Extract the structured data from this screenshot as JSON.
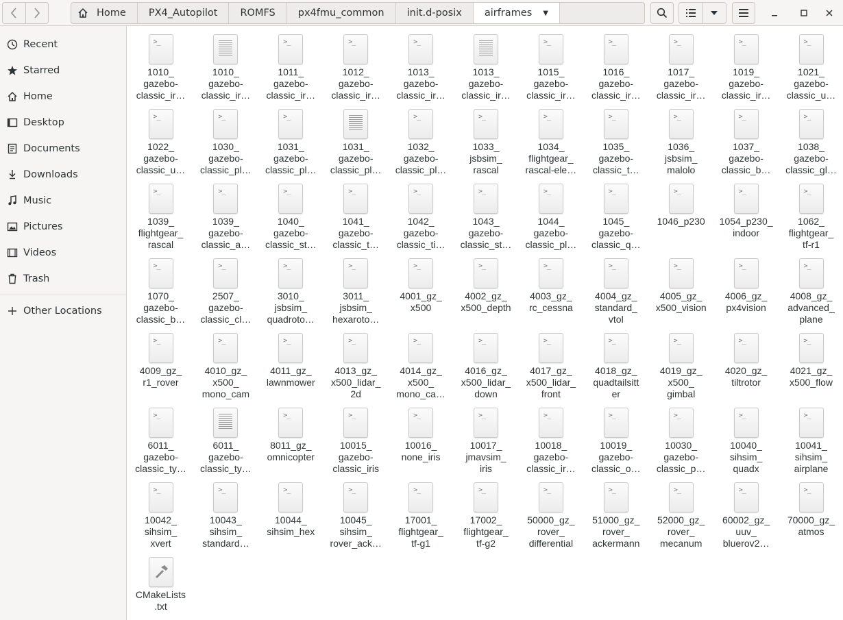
{
  "nav": {
    "back_label": "‹",
    "forward_label": "›"
  },
  "pathbar": {
    "crumbs": [
      "Home",
      "PX4_Autopilot",
      "ROMFS",
      "px4fmu_common",
      "init.d-posix",
      "airframes"
    ]
  },
  "sidebar": {
    "items": [
      {
        "label": "Recent",
        "icon": "clock-icon"
      },
      {
        "label": "Starred",
        "icon": "star-icon"
      },
      {
        "label": "Home",
        "icon": "home-icon"
      },
      {
        "label": "Desktop",
        "icon": "desktop-icon"
      },
      {
        "label": "Documents",
        "icon": "documents-icon"
      },
      {
        "label": "Downloads",
        "icon": "download-icon"
      },
      {
        "label": "Music",
        "icon": "music-icon"
      },
      {
        "label": "Pictures",
        "icon": "pictures-icon"
      },
      {
        "label": "Videos",
        "icon": "videos-icon"
      },
      {
        "label": "Trash",
        "icon": "trash-icon"
      }
    ],
    "other_locations": "Other Locations"
  },
  "files": [
    {
      "name": [
        "1010_",
        "gazebo-",
        "classic_ir…"
      ],
      "type": "script"
    },
    {
      "name": [
        "1010_",
        "gazebo-",
        "classic_ir…"
      ],
      "type": "text"
    },
    {
      "name": [
        "1011_",
        "gazebo-",
        "classic_ir…"
      ],
      "type": "script"
    },
    {
      "name": [
        "1012_",
        "gazebo-",
        "classic_ir…"
      ],
      "type": "script"
    },
    {
      "name": [
        "1013_",
        "gazebo-",
        "classic_ir…"
      ],
      "type": "script"
    },
    {
      "name": [
        "1013_",
        "gazebo-",
        "classic_ir…"
      ],
      "type": "text"
    },
    {
      "name": [
        "1015_",
        "gazebo-",
        "classic_ir…"
      ],
      "type": "script"
    },
    {
      "name": [
        "1016_",
        "gazebo-",
        "classic_ir…"
      ],
      "type": "script"
    },
    {
      "name": [
        "1017_",
        "gazebo-",
        "classic_ir…"
      ],
      "type": "script"
    },
    {
      "name": [
        "1019_",
        "gazebo-",
        "classic_ir…"
      ],
      "type": "script"
    },
    {
      "name": [
        "1021_",
        "gazebo-",
        "classic_u…"
      ],
      "type": "script"
    },
    {
      "name": [
        "1022_",
        "gazebo-",
        "classic_u…"
      ],
      "type": "script"
    },
    {
      "name": [
        "1030_",
        "gazebo-",
        "classic_pl…"
      ],
      "type": "script"
    },
    {
      "name": [
        "1031_",
        "gazebo-",
        "classic_pl…"
      ],
      "type": "script"
    },
    {
      "name": [
        "1031_",
        "gazebo-",
        "classic_pl…"
      ],
      "type": "text"
    },
    {
      "name": [
        "1032_",
        "gazebo-",
        "classic_pl…"
      ],
      "type": "script"
    },
    {
      "name": [
        "1033_",
        "jsbsim_",
        "rascal"
      ],
      "type": "script"
    },
    {
      "name": [
        "1034_",
        "flightgear_",
        "rascal-ele…"
      ],
      "type": "script"
    },
    {
      "name": [
        "1035_",
        "gazebo-",
        "classic_t…"
      ],
      "type": "script"
    },
    {
      "name": [
        "1036_",
        "jsbsim_",
        "malolo"
      ],
      "type": "script"
    },
    {
      "name": [
        "1037_",
        "gazebo-",
        "classic_b…"
      ],
      "type": "script"
    },
    {
      "name": [
        "1038_",
        "gazebo-",
        "classic_gl…"
      ],
      "type": "script"
    },
    {
      "name": [
        "1039_",
        "flightgear_",
        "rascal"
      ],
      "type": "script"
    },
    {
      "name": [
        "1039_",
        "gazebo-",
        "classic_a…"
      ],
      "type": "script"
    },
    {
      "name": [
        "1040_",
        "gazebo-",
        "classic_st…"
      ],
      "type": "script"
    },
    {
      "name": [
        "1041_",
        "gazebo-",
        "classic_t…"
      ],
      "type": "script"
    },
    {
      "name": [
        "1042_",
        "gazebo-",
        "classic_ti…"
      ],
      "type": "script"
    },
    {
      "name": [
        "1043_",
        "gazebo-",
        "classic_st…"
      ],
      "type": "script"
    },
    {
      "name": [
        "1044_",
        "gazebo-",
        "classic_pl…"
      ],
      "type": "script"
    },
    {
      "name": [
        "1045_",
        "gazebo-",
        "classic_q…"
      ],
      "type": "script"
    },
    {
      "name": [
        "1046_p230"
      ],
      "type": "script"
    },
    {
      "name": [
        "1054_p230_",
        "indoor"
      ],
      "type": "script"
    },
    {
      "name": [
        "1062_",
        "flightgear_",
        "tf-r1"
      ],
      "type": "script"
    },
    {
      "name": [
        "1070_",
        "gazebo-",
        "classic_b…"
      ],
      "type": "script"
    },
    {
      "name": [
        "2507_",
        "gazebo-",
        "classic_cl…"
      ],
      "type": "script"
    },
    {
      "name": [
        "3010_",
        "jsbsim_",
        "quadroto…"
      ],
      "type": "script"
    },
    {
      "name": [
        "3011_",
        "jsbsim_",
        "hexaroto…"
      ],
      "type": "script"
    },
    {
      "name": [
        "4001_gz_",
        "x500"
      ],
      "type": "script"
    },
    {
      "name": [
        "4002_gz_",
        "x500_depth"
      ],
      "type": "script"
    },
    {
      "name": [
        "4003_gz_",
        "rc_cessna"
      ],
      "type": "script"
    },
    {
      "name": [
        "4004_gz_",
        "standard_",
        "vtol"
      ],
      "type": "script"
    },
    {
      "name": [
        "4005_gz_",
        "x500_vision"
      ],
      "type": "script"
    },
    {
      "name": [
        "4006_gz_",
        "px4vision"
      ],
      "type": "script"
    },
    {
      "name": [
        "4008_gz_",
        "advanced_",
        "plane"
      ],
      "type": "script"
    },
    {
      "name": [
        "4009_gz_",
        "r1_rover"
      ],
      "type": "script"
    },
    {
      "name": [
        "4010_gz_",
        "x500_",
        "mono_cam"
      ],
      "type": "script"
    },
    {
      "name": [
        "4011_gz_",
        "lawnmower"
      ],
      "type": "script"
    },
    {
      "name": [
        "4013_gz_",
        "x500_lidar_",
        "2d"
      ],
      "type": "script"
    },
    {
      "name": [
        "4014_gz_",
        "x500_",
        "mono_ca…"
      ],
      "type": "script"
    },
    {
      "name": [
        "4016_gz_",
        "x500_lidar_",
        "down"
      ],
      "type": "script"
    },
    {
      "name": [
        "4017_gz_",
        "x500_lidar_",
        "front"
      ],
      "type": "script"
    },
    {
      "name": [
        "4018_gz_",
        "quadtailsitt",
        "er"
      ],
      "type": "script"
    },
    {
      "name": [
        "4019_gz_",
        "x500_",
        "gimbal"
      ],
      "type": "script"
    },
    {
      "name": [
        "4020_gz_",
        "tiltrotor"
      ],
      "type": "script"
    },
    {
      "name": [
        "4021_gz_",
        "x500_flow"
      ],
      "type": "script"
    },
    {
      "name": [
        "6011_",
        "gazebo-",
        "classic_ty…"
      ],
      "type": "script"
    },
    {
      "name": [
        "6011_",
        "gazebo-",
        "classic_ty…"
      ],
      "type": "text"
    },
    {
      "name": [
        "8011_gz_",
        "omnicopter"
      ],
      "type": "script"
    },
    {
      "name": [
        "10015_",
        "gazebo-",
        "classic_iris"
      ],
      "type": "script"
    },
    {
      "name": [
        "10016_",
        "none_iris"
      ],
      "type": "script"
    },
    {
      "name": [
        "10017_",
        "jmavsim_",
        "iris"
      ],
      "type": "script"
    },
    {
      "name": [
        "10018_",
        "gazebo-",
        "classic_ir…"
      ],
      "type": "script"
    },
    {
      "name": [
        "10019_",
        "gazebo-",
        "classic_o…"
      ],
      "type": "script"
    },
    {
      "name": [
        "10030_",
        "gazebo-",
        "classic_p…"
      ],
      "type": "script"
    },
    {
      "name": [
        "10040_",
        "sihsim_",
        "quadx"
      ],
      "type": "script"
    },
    {
      "name": [
        "10041_",
        "sihsim_",
        "airplane"
      ],
      "type": "script"
    },
    {
      "name": [
        "10042_",
        "sihsim_",
        "xvert"
      ],
      "type": "script"
    },
    {
      "name": [
        "10043_",
        "sihsim_",
        "standard…"
      ],
      "type": "script"
    },
    {
      "name": [
        "10044_",
        "sihsim_hex"
      ],
      "type": "script"
    },
    {
      "name": [
        "10045_",
        "sihsim_",
        "rover_ack…"
      ],
      "type": "script"
    },
    {
      "name": [
        "17001_",
        "flightgear_",
        "tf-g1"
      ],
      "type": "script"
    },
    {
      "name": [
        "17002_",
        "flightgear_",
        "tf-g2"
      ],
      "type": "script"
    },
    {
      "name": [
        "50000_gz_",
        "rover_",
        "differential"
      ],
      "type": "script"
    },
    {
      "name": [
        "51000_gz_",
        "rover_",
        "ackermann"
      ],
      "type": "script"
    },
    {
      "name": [
        "52000_gz_",
        "rover_",
        "mecanum"
      ],
      "type": "script"
    },
    {
      "name": [
        "60002_gz_",
        "uuv_",
        "bluerov2…"
      ],
      "type": "script"
    },
    {
      "name": [
        "70000_gz_",
        "atmos"
      ],
      "type": "script"
    },
    {
      "name": [
        "CMakeLists",
        ".txt"
      ],
      "type": "cmake"
    }
  ]
}
